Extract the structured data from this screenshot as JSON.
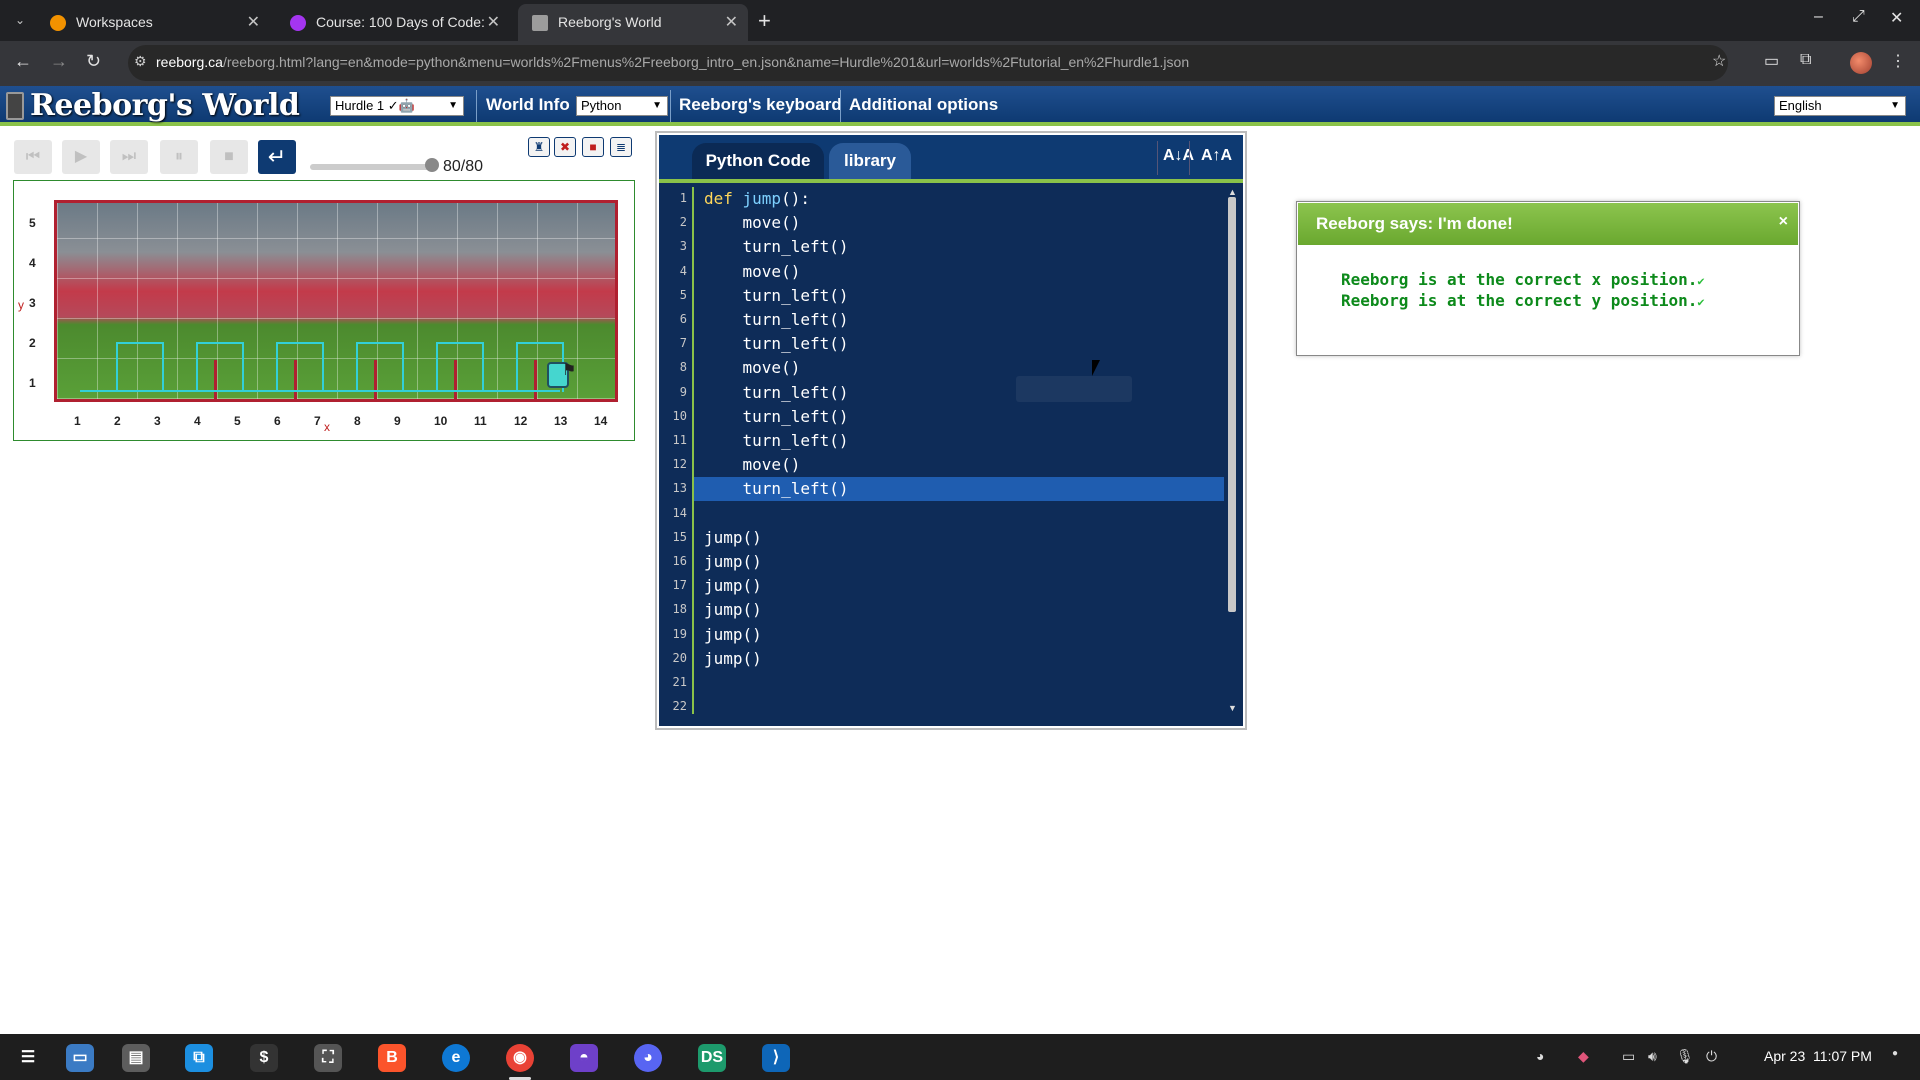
{
  "browser": {
    "tabs": [
      {
        "title": "Workspaces",
        "icon": "g-workspaces-icon",
        "color": "#f29200"
      },
      {
        "title": "Course: 100 Days of Code:",
        "icon": "udemy-icon",
        "color": "#a435f0"
      },
      {
        "title": "Reeborg's World",
        "icon": "reeborg-favicon-icon",
        "color": "#9c9c9c"
      }
    ],
    "url_host": "reeborg.ca",
    "url_path": "/reeborg.html?lang=en&mode=python&menu=worlds%2Fmenus%2Freeborg_intro_en.json&name=Hurdle%201&url=worlds%2Ftutorial_en%2Fhurdle1.json"
  },
  "header": {
    "title": "Reeborg's World",
    "world_select": "Hurdle 1 ✓🤖",
    "world_info": "World Info",
    "language_select": "Python",
    "keyboard": "Reeborg's keyboard",
    "additional": "Additional options",
    "ui_language": "English",
    "accent": "#0e3a72",
    "green": "#8ac249"
  },
  "controls": {
    "step_label": "80/80",
    "speed_fraction": 1.0
  },
  "world": {
    "y_ticks": [
      "5",
      "4",
      "3",
      "2",
      "1"
    ],
    "x_ticks": [
      "1",
      "2",
      "3",
      "4",
      "5",
      "6",
      "7",
      "8",
      "9",
      "10",
      "11",
      "12",
      "13",
      "14"
    ],
    "x_axis": "x",
    "y_axis": "y"
  },
  "editor": {
    "tab_code": "Python Code",
    "tab_library": "library",
    "font_down": "A↓A",
    "font_up": "A↑A",
    "highlighted_line": 13,
    "lines": [
      "def jump():",
      "    move()",
      "    turn_left()",
      "    move()",
      "    turn_left()",
      "    turn_left()",
      "    turn_left()",
      "    move()",
      "    turn_left()",
      "    turn_left()",
      "    turn_left()",
      "    move()",
      "    turn_left()",
      "",
      "jump()",
      "jump()",
      "jump()",
      "jump()",
      "jump()",
      "jump()",
      "",
      ""
    ]
  },
  "dialog": {
    "title": "Reeborg says: I'm done!",
    "close": "×",
    "lines": [
      "Reeborg is at the correct x position.",
      "Reeborg is at the correct y position."
    ],
    "check": "✔"
  },
  "taskbar": {
    "date": "Apr 23",
    "time": "11:07 PM"
  }
}
